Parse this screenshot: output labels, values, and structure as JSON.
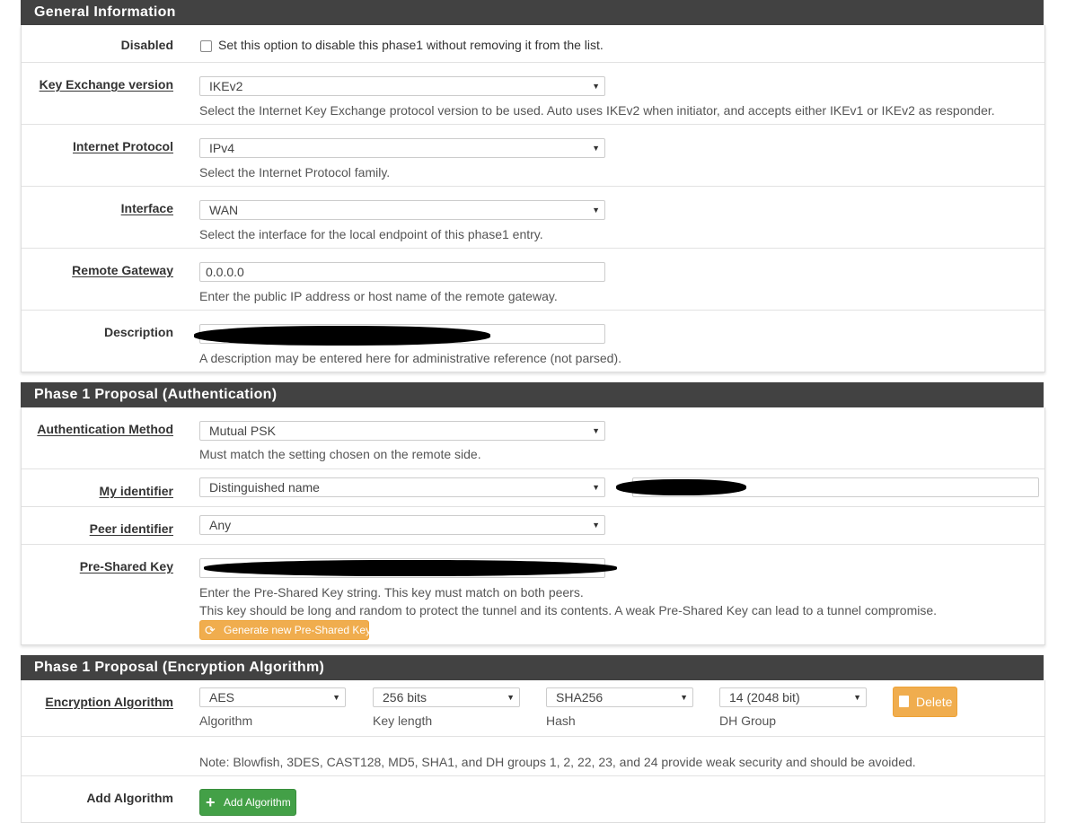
{
  "general": {
    "heading": "General Information",
    "disabled": {
      "label": "Disabled",
      "checkbox_text": "Set this option to disable this phase1 without removing it from the list."
    },
    "key_exchange": {
      "label": "Key Exchange version",
      "value": "IKEv2",
      "help": "Select the Internet Key Exchange protocol version to be used. Auto uses IKEv2 when initiator, and accepts either IKEv1 or IKEv2 as responder."
    },
    "internet_protocol": {
      "label": "Internet Protocol",
      "value": "IPv4",
      "help": "Select the Internet Protocol family."
    },
    "interface": {
      "label": "Interface",
      "value": "WAN",
      "help": "Select the interface for the local endpoint of this phase1 entry."
    },
    "remote_gateway": {
      "label": "Remote Gateway",
      "value": "0.0.0.0",
      "help": "Enter the public IP address or host name of the remote gateway."
    },
    "description": {
      "label": "Description",
      "help": "A description may be entered here for administrative reference (not parsed)."
    }
  },
  "auth": {
    "heading": "Phase 1 Proposal (Authentication)",
    "method": {
      "label": "Authentication Method",
      "value": "Mutual PSK",
      "help": "Must match the setting chosen on the remote side."
    },
    "my_identifier": {
      "label": "My identifier",
      "value": "Distinguished name"
    },
    "peer_identifier": {
      "label": "Peer identifier",
      "value": "Any"
    },
    "psk": {
      "label": "Pre-Shared Key",
      "help1": "Enter the Pre-Shared Key string. This key must match on both peers.",
      "help2": "This key should be long and random to protect the tunnel and its contents. A weak Pre-Shared Key can lead to a tunnel compromise.",
      "generate_button": "Generate new Pre-Shared Key"
    }
  },
  "encryption": {
    "heading": "Phase 1 Proposal (Encryption Algorithm)",
    "label": "Encryption Algorithm",
    "algorithm": {
      "value": "AES",
      "sub": "Algorithm"
    },
    "key_length": {
      "value": "256 bits",
      "sub": "Key length"
    },
    "hash": {
      "value": "SHA256",
      "sub": "Hash"
    },
    "dh_group": {
      "value": "14 (2048 bit)",
      "sub": "DH Group"
    },
    "delete_button": "Delete",
    "note": "Note: Blowfish, 3DES, CAST128, MD5, SHA1, and DH groups 1, 2, 22, 23, and 24 provide weak security and should be avoided.",
    "add_label": "Add Algorithm",
    "add_button": "Add Algorithm"
  },
  "colors": {
    "heading_bg": "#424242",
    "warning": "#f0ad4e",
    "success": "#43a047"
  }
}
